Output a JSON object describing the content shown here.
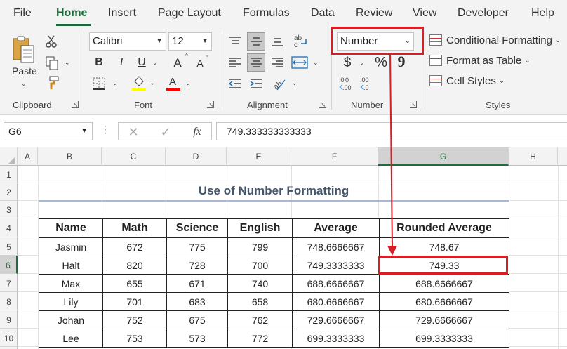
{
  "menu": {
    "items": [
      "File",
      "Home",
      "Insert",
      "Page Layout",
      "Formulas",
      "Data",
      "Review",
      "View",
      "Developer",
      "Help"
    ],
    "active": "Home"
  },
  "ribbon": {
    "clipboard": {
      "paste_label": "Paste",
      "group_label": "Clipboard"
    },
    "font": {
      "font_name": "Calibri",
      "font_size": "12",
      "group_label": "Font",
      "bold": "B",
      "italic": "I",
      "underline": "U",
      "grow": "A",
      "shrink": "A",
      "font_color_letter": "A"
    },
    "alignment": {
      "group_label": "Alignment"
    },
    "number": {
      "format": "Number",
      "group_label": "Number",
      "currency": "$",
      "percent": "%",
      "comma": "9"
    },
    "styles": {
      "group_label": "Styles",
      "conditional_formatting": "Conditional Formatting",
      "format_as_table": "Format as Table",
      "cell_styles": "Cell Styles"
    },
    "colors": {
      "highlight": "#ffff00",
      "font_color": "#ff0000",
      "accent": "#1d6a3a",
      "annotation": "#d41f26"
    }
  },
  "formula_bar": {
    "name_box": "G6",
    "fx": "fx",
    "value": "749.333333333333"
  },
  "grid": {
    "columns": [
      "A",
      "B",
      "C",
      "D",
      "E",
      "F",
      "G",
      "H"
    ],
    "rows": [
      "1",
      "2",
      "3",
      "4",
      "5",
      "6",
      "7",
      "8",
      "9",
      "10"
    ],
    "selected_column": "G",
    "selected_row": "6"
  },
  "sheet": {
    "title": "Use of Number Formatting",
    "table": {
      "headers": [
        "Name",
        "Math",
        "Science",
        "English",
        "Average",
        "Rounded Average"
      ],
      "rows": [
        [
          "Jasmin",
          "672",
          "775",
          "799",
          "748.6666667",
          "748.67"
        ],
        [
          "Halt",
          "820",
          "728",
          "700",
          "749.3333333",
          "749.33"
        ],
        [
          "Max",
          "655",
          "671",
          "740",
          "688.6666667",
          "688.6666667"
        ],
        [
          "Lily",
          "701",
          "683",
          "658",
          "680.6666667",
          "680.6666667"
        ],
        [
          "Johan",
          "752",
          "675",
          "762",
          "729.6666667",
          "729.6666667"
        ],
        [
          "Lee",
          "753",
          "573",
          "772",
          "699.3333333",
          "699.3333333"
        ]
      ]
    }
  }
}
